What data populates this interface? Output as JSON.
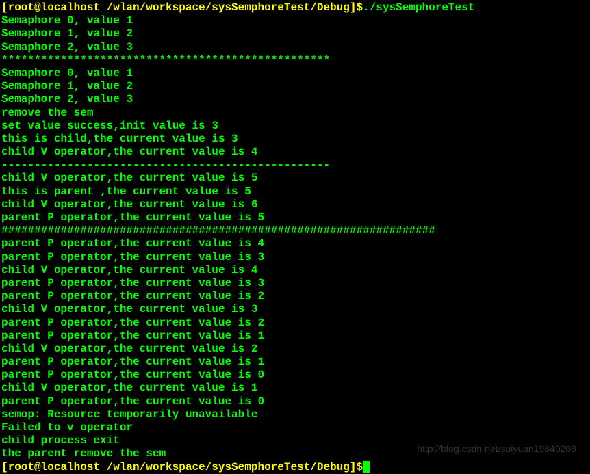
{
  "prompt1": {
    "prefix": "[root@localhost /wlan/workspace/sysSemphoreTest/Debug]$",
    "command": "./sysSemphoreTest"
  },
  "lines": [
    "Semaphore 0, value 1",
    "Semaphore 1, value 2",
    "Semaphore 2, value 3",
    "**************************************************",
    "Semaphore 0, value 1",
    "Semaphore 1, value 2",
    "Semaphore 2, value 3",
    "remove the sem",
    "set value success,init value is 3",
    "this is child,the current value is 3",
    "child V operator,the current value is 4",
    "--------------------------------------------------",
    "child V operator,the current value is 5",
    "this is parent ,the current value is 5",
    "child V operator,the current value is 6",
    "parent P operator,the current value is 5",
    "##################################################################",
    "parent P operator,the current value is 4",
    "parent P operator,the current value is 3",
    "child V operator,the current value is 4",
    "parent P operator,the current value is 3",
    "parent P operator,the current value is 2",
    "child V operator,the current value is 3",
    "parent P operator,the current value is 2",
    "parent P operator,the current value is 1",
    "child V operator,the current value is 2",
    "parent P operator,the current value is 1",
    "parent P operator,the current value is 0",
    "child V operator,the current value is 1",
    "parent P operator,the current value is 0",
    "semop: Resource temporarily unavailable",
    "Failed to v operator",
    "child process exit",
    "the parent remove the sem"
  ],
  "prompt2": {
    "prefix": "[root@localhost /wlan/workspace/sysSemphoreTest/Debug]$"
  },
  "watermark": "http://blog.csdn.net/suiyuan19840208"
}
